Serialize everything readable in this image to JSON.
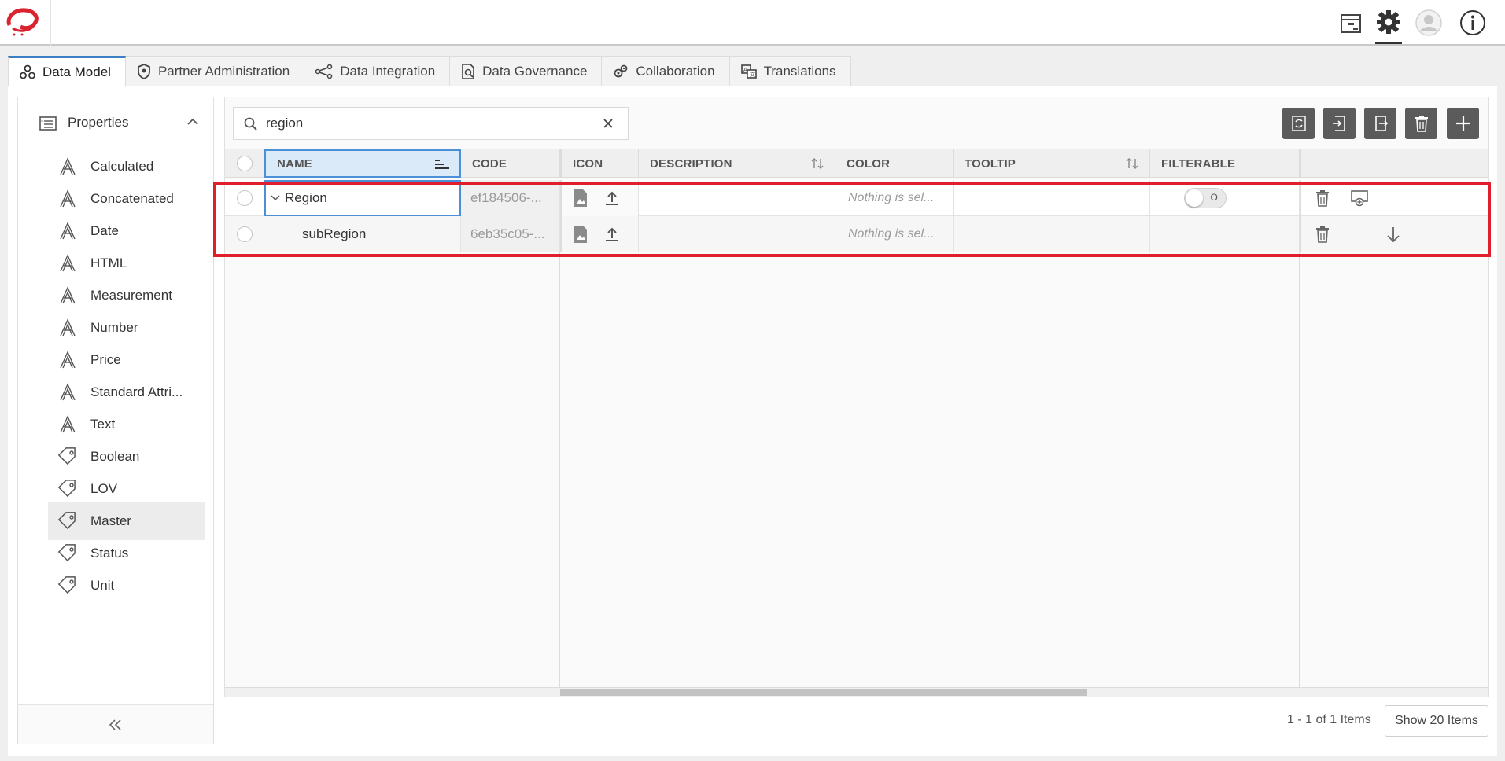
{
  "header": {
    "icons": [
      "archive-icon",
      "settings-gear-icon",
      "user-avatar-icon",
      "info-icon"
    ]
  },
  "tabs": [
    {
      "label": "Data Model",
      "icon": "data-model-icon",
      "active": true
    },
    {
      "label": "Partner Administration",
      "icon": "shield-icon"
    },
    {
      "label": "Data Integration",
      "icon": "integration-icon"
    },
    {
      "label": "Data Governance",
      "icon": "governance-icon"
    },
    {
      "label": "Collaboration",
      "icon": "collaboration-icon"
    },
    {
      "label": "Translations",
      "icon": "translations-icon"
    }
  ],
  "sidebar": {
    "header": "Properties",
    "items": [
      {
        "label": "Calculated",
        "icon": "attribute-icon"
      },
      {
        "label": "Concatenated",
        "icon": "attribute-icon"
      },
      {
        "label": "Date",
        "icon": "attribute-icon"
      },
      {
        "label": "HTML",
        "icon": "attribute-icon"
      },
      {
        "label": "Measurement",
        "icon": "attribute-icon"
      },
      {
        "label": "Number",
        "icon": "attribute-icon"
      },
      {
        "label": "Price",
        "icon": "attribute-icon"
      },
      {
        "label": "Standard Attri...",
        "icon": "attribute-icon"
      },
      {
        "label": "Text",
        "icon": "attribute-icon"
      },
      {
        "label": "Boolean",
        "icon": "tag-icon"
      },
      {
        "label": "LOV",
        "icon": "tag-icon"
      },
      {
        "label": "Master",
        "icon": "tag-icon",
        "active": true
      },
      {
        "label": "Status",
        "icon": "tag-icon"
      },
      {
        "label": "Unit",
        "icon": "tag-icon"
      }
    ]
  },
  "search": {
    "value": "region"
  },
  "toolbar": {
    "buttons": [
      "refresh-icon",
      "import-icon",
      "export-icon",
      "delete-icon",
      "add-icon"
    ]
  },
  "table": {
    "columns": [
      "NAME",
      "CODE",
      "ICON",
      "DESCRIPTION",
      "COLOR",
      "TOOLTIP",
      "FILTERABLE"
    ],
    "rows": [
      {
        "name": "Region",
        "code": "ef184506-...",
        "color": "Nothing is sel...",
        "filterable_toggle": "O"
      },
      {
        "name": "subRegion",
        "code": "6eb35c05-...",
        "color": "Nothing is sel..."
      }
    ]
  },
  "pagination": {
    "summary": "1 - 1 of 1 Items",
    "page_size_button": "Show 20 Items"
  }
}
